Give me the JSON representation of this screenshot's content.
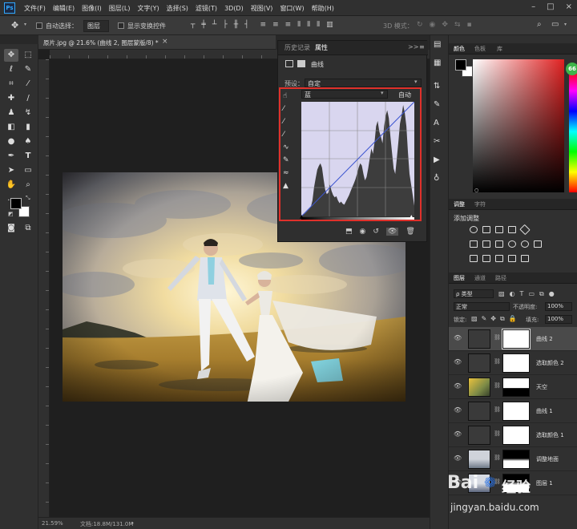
{
  "app": {
    "logo": "Ps",
    "menus": [
      "文件(F)",
      "编辑(E)",
      "图像(I)",
      "图层(L)",
      "文字(Y)",
      "选择(S)",
      "滤镜(T)",
      "3D(D)",
      "视图(V)",
      "窗口(W)",
      "帮助(H)"
    ]
  },
  "options": {
    "auto_select_label": "自动选择：",
    "layer_dropdown": "图层",
    "show_transform_label": "显示变换控件",
    "mode_3d": "3D 模式："
  },
  "document": {
    "tab_title": "原片.jpg @ 21.6% (曲线 2, 图层蒙版/8) *",
    "close": "×"
  },
  "status": {
    "zoom": "21.59%",
    "doc_info": "文档:18.8M/131.0M"
  },
  "properties_panel": {
    "tabs": [
      "历史记录",
      "属性"
    ],
    "active_tab": "属性",
    "collapse": ">>",
    "type_label": "曲线",
    "preset_label": "预设：",
    "preset_value": "自定",
    "channel": "蓝",
    "auto_button": "自动",
    "histogram": [
      2,
      3,
      5,
      8,
      11,
      14,
      18,
      30,
      55,
      72,
      88,
      95,
      100,
      92,
      70,
      50,
      42,
      45,
      60,
      48,
      40,
      36,
      38,
      30,
      25,
      28,
      24,
      22,
      28,
      34,
      40,
      48,
      55,
      62,
      70,
      80,
      92,
      100,
      96,
      80,
      68,
      74,
      90,
      110,
      128,
      118,
      140,
      170,
      180,
      160,
      150,
      138,
      170,
      190,
      200,
      185,
      150,
      120,
      90,
      80,
      110,
      140,
      175,
      190,
      210,
      195,
      170,
      120,
      80,
      60,
      40,
      20
    ]
  },
  "right": {
    "color_tabs": [
      "颜色",
      "色板",
      "库"
    ],
    "adjust_tabs": [
      "调整",
      "字符"
    ],
    "add_adjustment": "添加调整",
    "layers_tabs": [
      "图层",
      "通道",
      "路径"
    ],
    "filter_kind": "ρ 类型",
    "blend_mode": "正常",
    "opacity_label": "不透明度:",
    "opacity_value": "100%",
    "lock_label": "锁定:",
    "fill_label": "填充:",
    "fill_value": "100%",
    "layers": [
      {
        "name": "曲线 2",
        "selected": true
      },
      {
        "name": "选取颜色 2",
        "selected": false
      },
      {
        "name": "天空",
        "selected": false
      },
      {
        "name": "曲线 1",
        "selected": false
      },
      {
        "name": "选取颜色 1",
        "selected": false
      },
      {
        "name": "调整地面",
        "selected": false
      },
      {
        "name": "图层 1",
        "selected": false
      }
    ],
    "badge": "66"
  },
  "watermark": {
    "brand": "Bai",
    "brand2": "经验",
    "url": "jingyan.baidu.com"
  },
  "colors": {
    "highlight_box": "#e0312b",
    "menubar": "#303030",
    "panel": "#2f2f2f"
  }
}
